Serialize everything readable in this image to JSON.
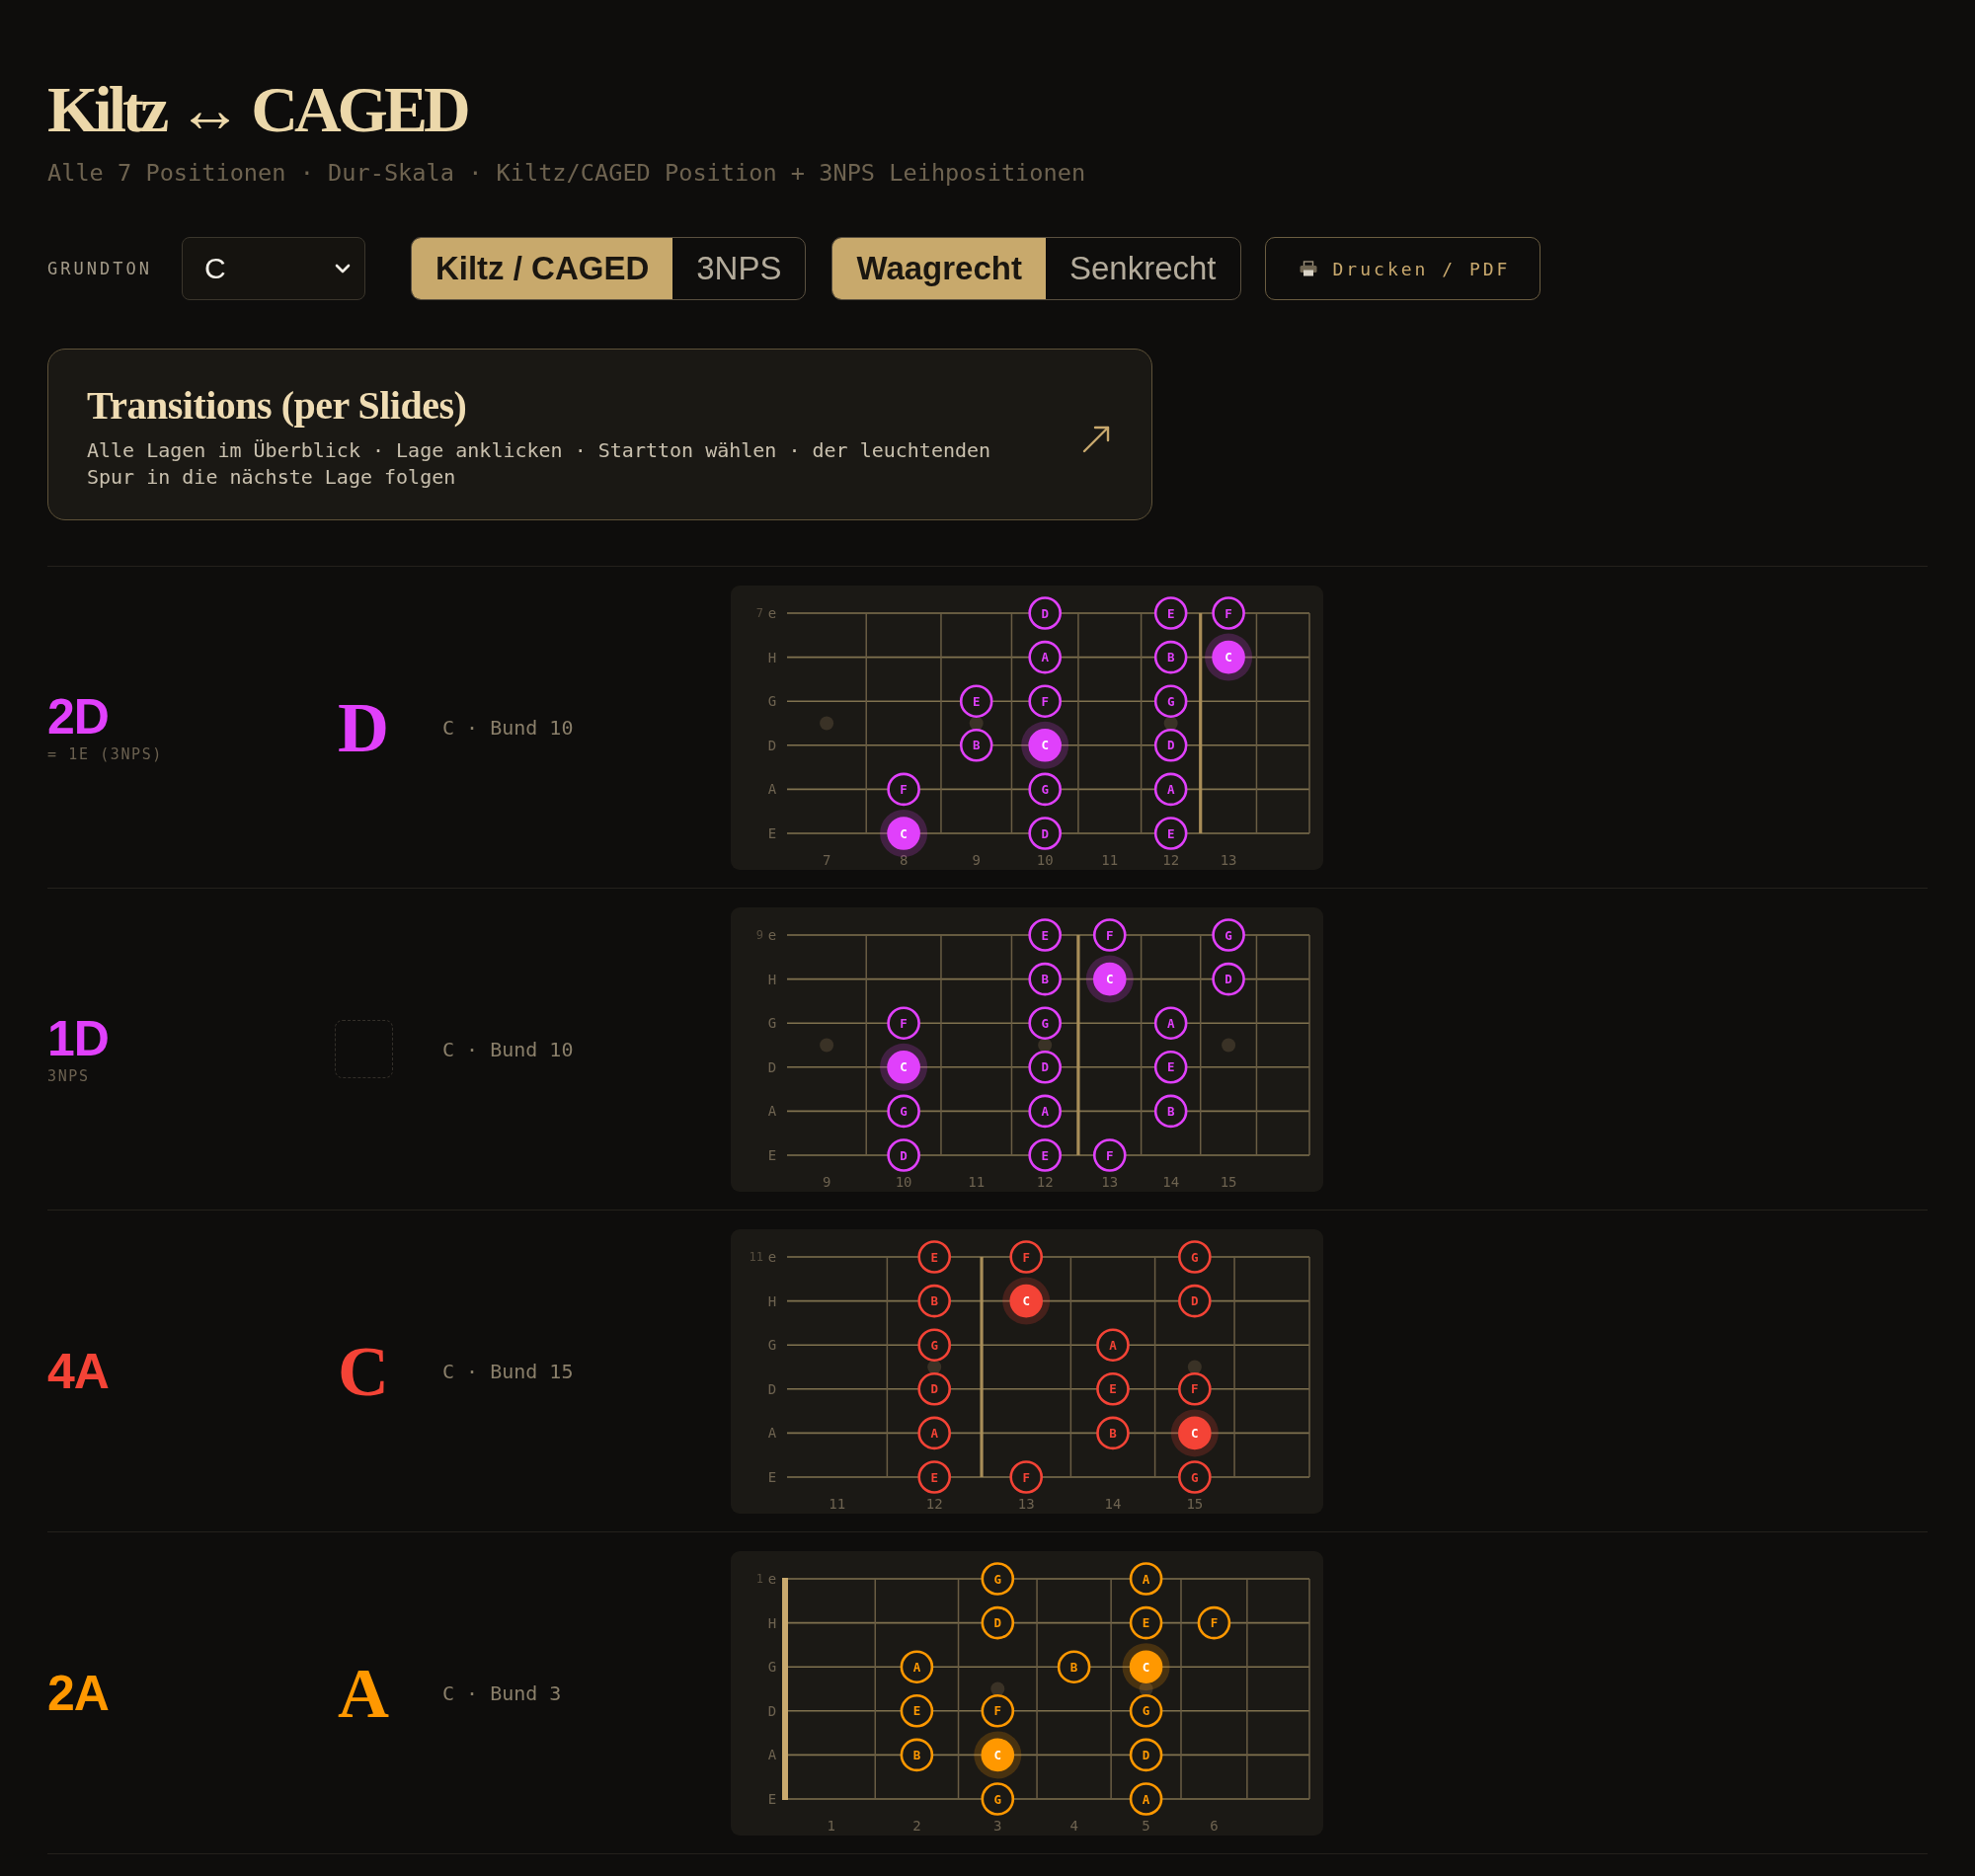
{
  "header": {
    "title": "Kiltz ↔ CAGED",
    "subtitle": "Alle 7 Positionen · Dur-Skala · Kiltz/CAGED Position + 3NPS Leihpositionen"
  },
  "controls": {
    "root_label": "GRUNDTON",
    "root_select": {
      "value": "C"
    },
    "system_tabs": [
      {
        "label": "Kiltz / CAGED",
        "selected": true
      },
      {
        "label": "3NPS",
        "selected": false
      }
    ],
    "orientation_tabs": [
      {
        "label": "Waagrecht",
        "selected": true
      },
      {
        "label": "Senkrecht",
        "selected": false
      }
    ],
    "print_button": {
      "label": "Drucken / PDF"
    }
  },
  "transitions_card": {
    "title": "Transitions (per Slides)",
    "description": "Alle Lagen im Überblick · Lage anklicken · Startton wählen · der leuchtenden Spur in die nächste Lage folgen"
  },
  "rows": [
    {
      "position": "2D",
      "note": "= 1E (3NPS)",
      "color": "#e040fb",
      "shape": {
        "kind": "letter",
        "letter": "D"
      },
      "root_fret": "C · Bund 10",
      "fretboard": {
        "start_fret": "7",
        "nut": false,
        "frets": [
          {
            "label": "7",
            "inlay": true,
            "octave_wire": false
          },
          {
            "label": "8",
            "inlay": false,
            "octave_wire": false
          },
          {
            "label": "9",
            "inlay": true,
            "octave_wire": false
          },
          {
            "label": "10",
            "inlay": false,
            "octave_wire": false
          },
          {
            "label": "11",
            "inlay": false,
            "octave_wire": false
          },
          {
            "label": "12",
            "inlay": true,
            "octave_wire": true
          },
          {
            "label": "13",
            "inlay": false,
            "octave_wire": false
          }
        ],
        "strings": [
          {
            "label": "e",
            "cells": [
              {
                "kind": "empty"
              },
              {
                "kind": "empty"
              },
              {
                "kind": "empty"
              },
              {
                "kind": "note",
                "note": "D",
                "root": false
              },
              {
                "kind": "empty"
              },
              {
                "kind": "note",
                "note": "E",
                "root": false
              },
              {
                "kind": "note",
                "note": "F",
                "root": false
              },
              {
                "kind": "empty"
              }
            ]
          },
          {
            "label": "H",
            "cells": [
              {
                "kind": "empty"
              },
              {
                "kind": "empty"
              },
              {
                "kind": "empty"
              },
              {
                "kind": "note",
                "note": "A",
                "root": false
              },
              {
                "kind": "empty"
              },
              {
                "kind": "note",
                "note": "B",
                "root": false
              },
              {
                "kind": "note",
                "note": "C",
                "root": true
              },
              {
                "kind": "empty"
              }
            ]
          },
          {
            "label": "G",
            "cells": [
              {
                "kind": "empty"
              },
              {
                "kind": "empty"
              },
              {
                "kind": "note",
                "note": "E",
                "root": false
              },
              {
                "kind": "note",
                "note": "F",
                "root": false
              },
              {
                "kind": "empty"
              },
              {
                "kind": "note",
                "note": "G",
                "root": false
              },
              {
                "kind": "empty"
              },
              {
                "kind": "empty"
              }
            ]
          },
          {
            "label": "D",
            "cells": [
              {
                "kind": "empty"
              },
              {
                "kind": "empty"
              },
              {
                "kind": "note",
                "note": "B",
                "root": false
              },
              {
                "kind": "note",
                "note": "C",
                "root": true
              },
              {
                "kind": "empty"
              },
              {
                "kind": "note",
                "note": "D",
                "root": false
              },
              {
                "kind": "empty"
              },
              {
                "kind": "empty"
              }
            ]
          },
          {
            "label": "A",
            "cells": [
              {
                "kind": "empty"
              },
              {
                "kind": "note",
                "note": "F",
                "root": false
              },
              {
                "kind": "empty"
              },
              {
                "kind": "note",
                "note": "G",
                "root": false
              },
              {
                "kind": "empty"
              },
              {
                "kind": "note",
                "note": "A",
                "root": false
              },
              {
                "kind": "empty"
              },
              {
                "kind": "empty"
              }
            ]
          },
          {
            "label": "E",
            "cells": [
              {
                "kind": "empty"
              },
              {
                "kind": "note",
                "note": "C",
                "root": true
              },
              {
                "kind": "empty"
              },
              {
                "kind": "note",
                "note": "D",
                "root": false
              },
              {
                "kind": "empty"
              },
              {
                "kind": "note",
                "note": "E",
                "root": false
              },
              {
                "kind": "empty"
              },
              {
                "kind": "empty"
              }
            ]
          }
        ]
      }
    },
    {
      "position": "1D",
      "note": "3NPS",
      "color": "#e040fb",
      "shape": {
        "kind": "empty"
      },
      "root_fret": "C · Bund 10",
      "fretboard": {
        "start_fret": "9",
        "nut": false,
        "frets": [
          {
            "label": "9",
            "inlay": true,
            "octave_wire": false
          },
          {
            "label": "10",
            "inlay": false,
            "octave_wire": false
          },
          {
            "label": "11",
            "inlay": false,
            "octave_wire": false
          },
          {
            "label": "12",
            "inlay": true,
            "octave_wire": true
          },
          {
            "label": "13",
            "inlay": false,
            "octave_wire": false
          },
          {
            "label": "14",
            "inlay": false,
            "octave_wire": false
          },
          {
            "label": "15",
            "inlay": true,
            "octave_wire": false
          }
        ],
        "strings": [
          {
            "label": "e",
            "cells": [
              {
                "kind": "empty"
              },
              {
                "kind": "empty"
              },
              {
                "kind": "empty"
              },
              {
                "kind": "note",
                "note": "E",
                "root": false
              },
              {
                "kind": "note",
                "note": "F",
                "root": false
              },
              {
                "kind": "empty"
              },
              {
                "kind": "note",
                "note": "G",
                "root": false
              },
              {
                "kind": "empty"
              }
            ]
          },
          {
            "label": "H",
            "cells": [
              {
                "kind": "empty"
              },
              {
                "kind": "empty"
              },
              {
                "kind": "empty"
              },
              {
                "kind": "note",
                "note": "B",
                "root": false
              },
              {
                "kind": "note",
                "note": "C",
                "root": true
              },
              {
                "kind": "empty"
              },
              {
                "kind": "note",
                "note": "D",
                "root": false
              },
              {
                "kind": "empty"
              }
            ]
          },
          {
            "label": "G",
            "cells": [
              {
                "kind": "empty"
              },
              {
                "kind": "note",
                "note": "F",
                "root": false
              },
              {
                "kind": "empty"
              },
              {
                "kind": "note",
                "note": "G",
                "root": false
              },
              {
                "kind": "empty"
              },
              {
                "kind": "note",
                "note": "A",
                "root": false
              },
              {
                "kind": "empty"
              },
              {
                "kind": "empty"
              }
            ]
          },
          {
            "label": "D",
            "cells": [
              {
                "kind": "empty"
              },
              {
                "kind": "note",
                "note": "C",
                "root": true
              },
              {
                "kind": "empty"
              },
              {
                "kind": "note",
                "note": "D",
                "root": false
              },
              {
                "kind": "empty"
              },
              {
                "kind": "note",
                "note": "E",
                "root": false
              },
              {
                "kind": "empty"
              },
              {
                "kind": "empty"
              }
            ]
          },
          {
            "label": "A",
            "cells": [
              {
                "kind": "empty"
              },
              {
                "kind": "note",
                "note": "G",
                "root": false
              },
              {
                "kind": "empty"
              },
              {
                "kind": "note",
                "note": "A",
                "root": false
              },
              {
                "kind": "empty"
              },
              {
                "kind": "note",
                "note": "B",
                "root": false
              },
              {
                "kind": "empty"
              },
              {
                "kind": "empty"
              }
            ]
          },
          {
            "label": "E",
            "cells": [
              {
                "kind": "empty"
              },
              {
                "kind": "note",
                "note": "D",
                "root": false
              },
              {
                "kind": "empty"
              },
              {
                "kind": "note",
                "note": "E",
                "root": false
              },
              {
                "kind": "note",
                "note": "F",
                "root": false
              },
              {
                "kind": "empty"
              },
              {
                "kind": "empty"
              },
              {
                "kind": "empty"
              }
            ]
          }
        ]
      }
    },
    {
      "position": "4A",
      "color": "#f44336",
      "shape": {
        "kind": "letter",
        "letter": "C"
      },
      "root_fret": "C · Bund 15",
      "fretboard": {
        "start_fret": "11",
        "nut": false,
        "frets": [
          {
            "label": "11",
            "inlay": false,
            "octave_wire": false
          },
          {
            "label": "12",
            "inlay": true,
            "octave_wire": true
          },
          {
            "label": "13",
            "inlay": false,
            "octave_wire": false
          },
          {
            "label": "14",
            "inlay": false,
            "octave_wire": false
          },
          {
            "label": "15",
            "inlay": true,
            "octave_wire": false
          }
        ],
        "strings": [
          {
            "label": "e",
            "cells": [
              {
                "kind": "empty"
              },
              {
                "kind": "note",
                "note": "E",
                "root": false
              },
              {
                "kind": "note",
                "note": "F",
                "root": false
              },
              {
                "kind": "empty"
              },
              {
                "kind": "note",
                "note": "G",
                "root": false
              },
              {
                "kind": "empty"
              }
            ]
          },
          {
            "label": "H",
            "cells": [
              {
                "kind": "empty"
              },
              {
                "kind": "note",
                "note": "B",
                "root": false
              },
              {
                "kind": "note",
                "note": "C",
                "root": true
              },
              {
                "kind": "empty"
              },
              {
                "kind": "note",
                "note": "D",
                "root": false
              },
              {
                "kind": "empty"
              }
            ]
          },
          {
            "label": "G",
            "cells": [
              {
                "kind": "empty"
              },
              {
                "kind": "note",
                "note": "G",
                "root": false
              },
              {
                "kind": "empty"
              },
              {
                "kind": "note",
                "note": "A",
                "root": false
              },
              {
                "kind": "empty"
              },
              {
                "kind": "empty"
              }
            ]
          },
          {
            "label": "D",
            "cells": [
              {
                "kind": "empty"
              },
              {
                "kind": "note",
                "note": "D",
                "root": false
              },
              {
                "kind": "empty"
              },
              {
                "kind": "note",
                "note": "E",
                "root": false
              },
              {
                "kind": "note",
                "note": "F",
                "root": false
              },
              {
                "kind": "empty"
              }
            ]
          },
          {
            "label": "A",
            "cells": [
              {
                "kind": "empty"
              },
              {
                "kind": "note",
                "note": "A",
                "root": false
              },
              {
                "kind": "empty"
              },
              {
                "kind": "note",
                "note": "B",
                "root": false
              },
              {
                "kind": "note",
                "note": "C",
                "root": true
              },
              {
                "kind": "empty"
              }
            ]
          },
          {
            "label": "E",
            "cells": [
              {
                "kind": "empty"
              },
              {
                "kind": "note",
                "note": "E",
                "root": false
              },
              {
                "kind": "note",
                "note": "F",
                "root": false
              },
              {
                "kind": "empty"
              },
              {
                "kind": "note",
                "note": "G",
                "root": false
              },
              {
                "kind": "empty"
              }
            ]
          }
        ]
      }
    },
    {
      "position": "2A",
      "color": "#ff9800",
      "shape": {
        "kind": "letter",
        "letter": "A"
      },
      "root_fret": "C · Bund 3",
      "fretboard": {
        "start_fret": "1",
        "nut": true,
        "frets": [
          {
            "label": "1",
            "inlay": false,
            "octave_wire": false
          },
          {
            "label": "2",
            "inlay": false,
            "octave_wire": false
          },
          {
            "label": "3",
            "inlay": true,
            "octave_wire": false
          },
          {
            "label": "4",
            "inlay": false,
            "octave_wire": false
          },
          {
            "label": "5",
            "inlay": true,
            "octave_wire": false
          },
          {
            "label": "6",
            "inlay": false,
            "octave_wire": false
          }
        ],
        "strings": [
          {
            "label": "e",
            "cells": [
              {
                "kind": "empty"
              },
              {
                "kind": "empty"
              },
              {
                "kind": "note",
                "note": "G",
                "root": false
              },
              {
                "kind": "empty"
              },
              {
                "kind": "note",
                "note": "A",
                "root": false
              },
              {
                "kind": "empty"
              },
              {
                "kind": "empty"
              }
            ]
          },
          {
            "label": "H",
            "cells": [
              {
                "kind": "empty"
              },
              {
                "kind": "empty"
              },
              {
                "kind": "note",
                "note": "D",
                "root": false
              },
              {
                "kind": "empty"
              },
              {
                "kind": "note",
                "note": "E",
                "root": false
              },
              {
                "kind": "note",
                "note": "F",
                "root": false
              },
              {
                "kind": "empty"
              }
            ]
          },
          {
            "label": "G",
            "cells": [
              {
                "kind": "empty"
              },
              {
                "kind": "note",
                "note": "A",
                "root": false
              },
              {
                "kind": "empty"
              },
              {
                "kind": "note",
                "note": "B",
                "root": false
              },
              {
                "kind": "note",
                "note": "C",
                "root": true
              },
              {
                "kind": "empty"
              },
              {
                "kind": "empty"
              }
            ]
          },
          {
            "label": "D",
            "cells": [
              {
                "kind": "empty"
              },
              {
                "kind": "note",
                "note": "E",
                "root": false
              },
              {
                "kind": "note",
                "note": "F",
                "root": false
              },
              {
                "kind": "empty"
              },
              {
                "kind": "note",
                "note": "G",
                "root": false
              },
              {
                "kind": "empty"
              },
              {
                "kind": "empty"
              }
            ]
          },
          {
            "label": "A",
            "cells": [
              {
                "kind": "empty"
              },
              {
                "kind": "note",
                "note": "B",
                "root": false
              },
              {
                "kind": "note",
                "note": "C",
                "root": true
              },
              {
                "kind": "empty"
              },
              {
                "kind": "note",
                "note": "D",
                "root": false
              },
              {
                "kind": "empty"
              },
              {
                "kind": "empty"
              }
            ]
          },
          {
            "label": "E",
            "cells": [
              {
                "kind": "empty"
              },
              {
                "kind": "empty"
              },
              {
                "kind": "note",
                "note": "G",
                "root": false
              },
              {
                "kind": "empty"
              },
              {
                "kind": "note",
                "note": "A",
                "root": false
              },
              {
                "kind": "empty"
              },
              {
                "kind": "empty"
              }
            ]
          }
        ]
      }
    }
  ]
}
